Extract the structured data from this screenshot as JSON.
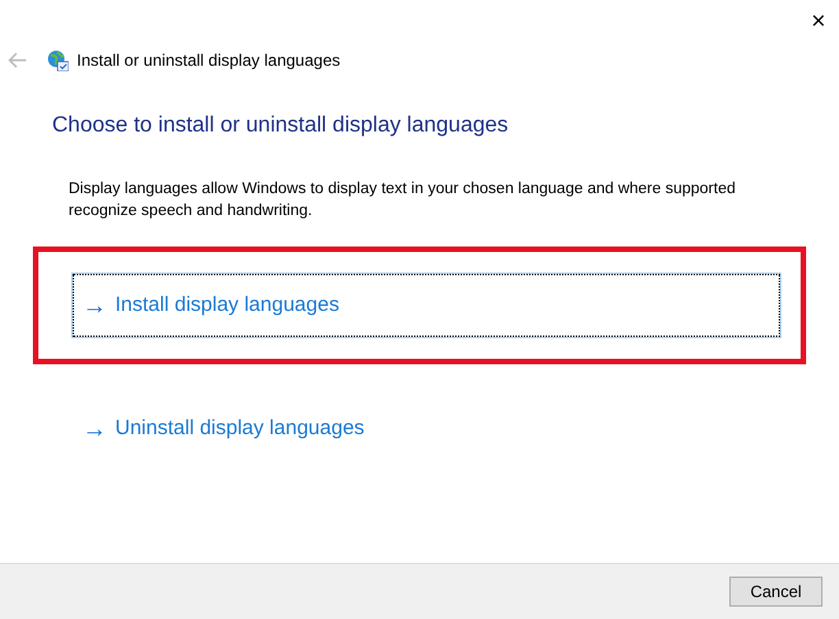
{
  "window": {
    "title": "Install or uninstall display languages",
    "close": "×"
  },
  "back": {
    "disabled": true
  },
  "heading": "Choose to install or uninstall display languages",
  "description": "Display languages allow Windows to display text in your chosen language and where supported recognize speech and handwriting.",
  "options": [
    {
      "arrow": "→",
      "label": "Install display languages",
      "selected": true,
      "highlighted": true
    },
    {
      "arrow": "→",
      "label": "Uninstall display languages",
      "selected": false,
      "highlighted": false
    }
  ],
  "buttons": [
    "Cancel"
  ]
}
